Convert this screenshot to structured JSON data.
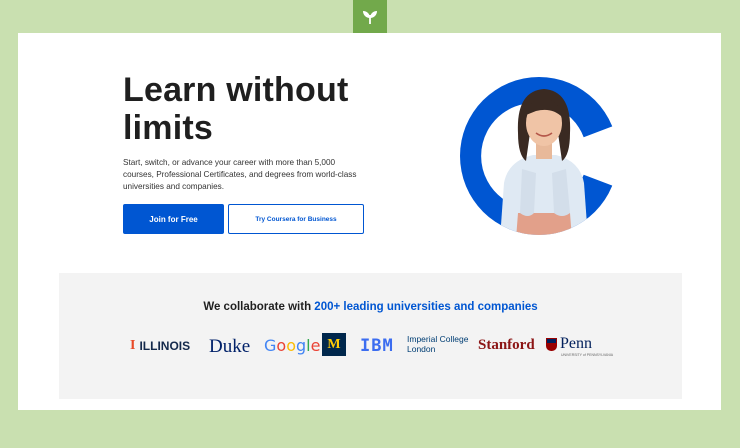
{
  "brand": {
    "badge_icon": "leaf-sprout-icon",
    "badge_color": "#72a94b",
    "page_background": "#c9e0b0",
    "primary_color": "#0056d2"
  },
  "hero": {
    "title": "Learn without limits",
    "description": "Start, switch, or advance your career with more than 5,000 courses, Professional Certificates, and degrees from world-class universities and companies.",
    "primary_button": "Join for Free",
    "secondary_button": "Try Coursera for Business"
  },
  "collaborate": {
    "heading_prefix": "We collaborate with ",
    "heading_highlight": "200+ leading universities and companies",
    "logos": {
      "illinois": "ILLINOIS",
      "duke": "Duke",
      "google": "Google",
      "michigan": "M",
      "ibm": "IBM",
      "imperial_line1": "Imperial College",
      "imperial_line2": "London",
      "stanford": "Stanford",
      "penn": "Penn",
      "penn_sub": "UNIVERSITY of PENNSYLVANIA"
    }
  }
}
